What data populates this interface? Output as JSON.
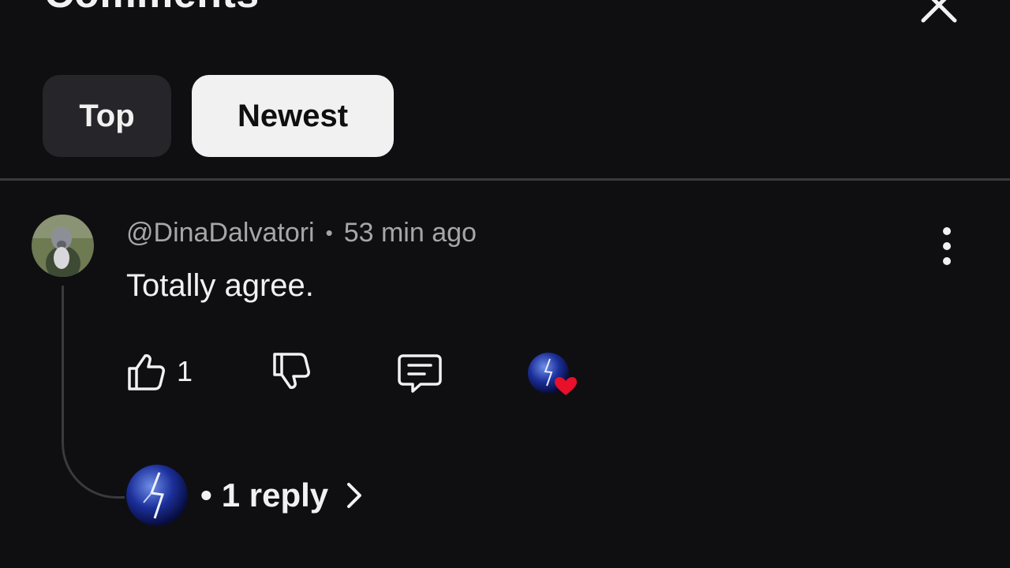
{
  "header": {
    "title": "Comments",
    "close_icon": "close-icon"
  },
  "tabs": [
    {
      "label": "Top",
      "selected": false
    },
    {
      "label": "Newest",
      "selected": true
    }
  ],
  "comment": {
    "author": "@DinaDalvatori",
    "separator": "•",
    "time": "53 min ago",
    "text": "Totally agree.",
    "likes": "1",
    "actions": [
      "thumbs-up-icon",
      "thumbs-down-icon",
      "reply-icon",
      "creator-heart-badge"
    ],
    "replies": {
      "prefix": "•",
      "label": "1 reply"
    }
  },
  "colors": {
    "background": "#0f0f12",
    "chip_active": "#f1f1f1",
    "chip_inactive": "#26262a",
    "meta_text": "#a6a6aa",
    "heart": "#e8102a"
  }
}
